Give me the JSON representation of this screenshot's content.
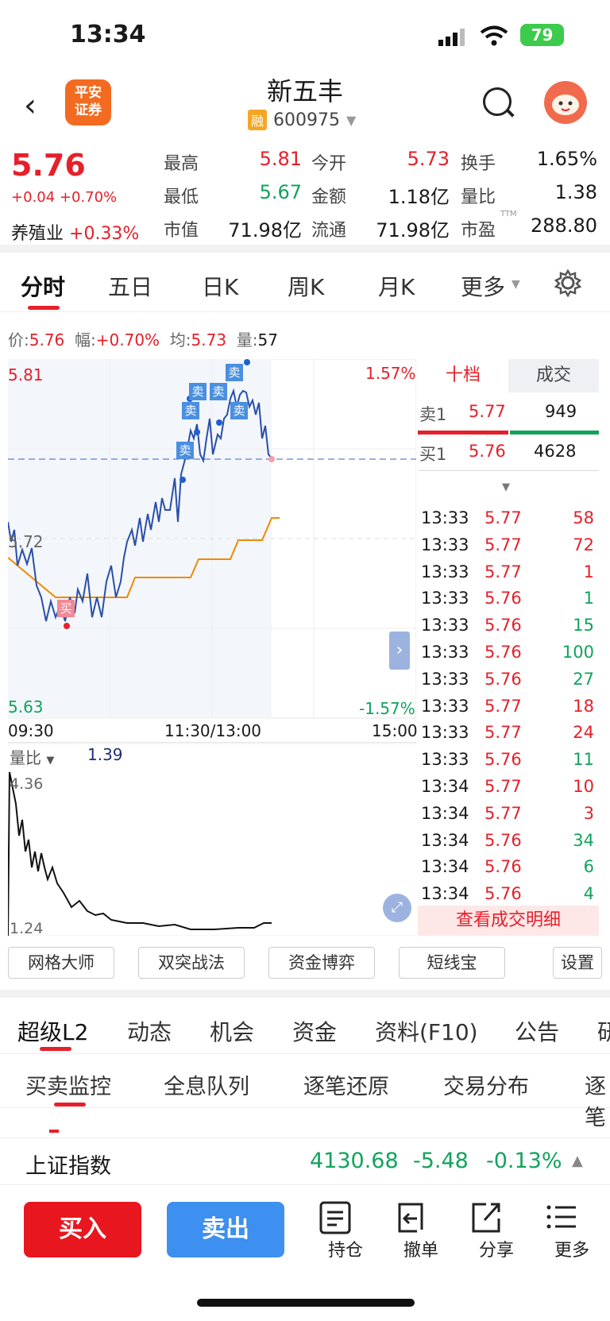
{
  "status": {
    "time": "13:34",
    "battery": "79"
  },
  "header": {
    "title": "新五丰",
    "margin_tag": "融",
    "code": "600975",
    "logo_text": "平安证券"
  },
  "quote": {
    "price": "5.76",
    "change": "+0.04 +0.70%",
    "sector_name": "养殖业",
    "sector_change": "+0.33%",
    "fields": [
      {
        "label": "最高",
        "value": "5.81",
        "color": "red"
      },
      {
        "label": "今开",
        "value": "5.73",
        "color": "red"
      },
      {
        "label": "换手",
        "value": "1.65%",
        "color": "black"
      },
      {
        "label": "最低",
        "value": "5.67",
        "color": "green"
      },
      {
        "label": "金额",
        "value": "1.18亿",
        "color": "black"
      },
      {
        "label": "量比",
        "value": "1.38",
        "color": "black"
      },
      {
        "label": "市值",
        "value": "71.98亿",
        "color": "black"
      },
      {
        "label": "流通",
        "value": "71.98亿",
        "color": "black"
      },
      {
        "label": "市盈",
        "value": "288.80",
        "color": "black"
      }
    ],
    "ttm": "TTM"
  },
  "tabs": [
    "分时",
    "五日",
    "日K",
    "周K",
    "月K",
    "更多"
  ],
  "infobar": {
    "price_label": "价:",
    "price": "5.76",
    "amp_label": "幅:",
    "amp": "+0.70%",
    "avg_label": "均:",
    "avg": "5.73",
    "vol_label": "量:",
    "vol": "57"
  },
  "chart": {
    "y_high": "5.81",
    "y_mid": "5.72",
    "y_low": "5.63",
    "pct_high": "1.57%",
    "pct_low": "-1.57%",
    "x_start": "09:30",
    "x_mid": "11:30/13:00",
    "x_end": "15:00",
    "vol_label": "量比",
    "vol_value": "1.39",
    "vol_high": "4.36",
    "vol_low": "1.24",
    "markers": {
      "buy": "买",
      "sell": "卖"
    }
  },
  "depth": {
    "tabs": [
      "十档",
      "成交"
    ],
    "sell1": {
      "label": "卖1",
      "price": "5.77",
      "vol": "949"
    },
    "buy1": {
      "label": "买1",
      "price": "5.76",
      "vol": "4628"
    },
    "ticks": [
      {
        "t": "13:33",
        "p": "5.77",
        "v": "58",
        "c": "red"
      },
      {
        "t": "13:33",
        "p": "5.77",
        "v": "72",
        "c": "red"
      },
      {
        "t": "13:33",
        "p": "5.77",
        "v": "1",
        "c": "red"
      },
      {
        "t": "13:33",
        "p": "5.76",
        "v": "1",
        "c": "green"
      },
      {
        "t": "13:33",
        "p": "5.76",
        "v": "15",
        "c": "green"
      },
      {
        "t": "13:33",
        "p": "5.76",
        "v": "100",
        "c": "green"
      },
      {
        "t": "13:33",
        "p": "5.76",
        "v": "27",
        "c": "green"
      },
      {
        "t": "13:33",
        "p": "5.77",
        "v": "18",
        "c": "red"
      },
      {
        "t": "13:33",
        "p": "5.77",
        "v": "24",
        "c": "red"
      },
      {
        "t": "13:33",
        "p": "5.76",
        "v": "11",
        "c": "green"
      },
      {
        "t": "13:34",
        "p": "5.77",
        "v": "10",
        "c": "red"
      },
      {
        "t": "13:34",
        "p": "5.77",
        "v": "3",
        "c": "red"
      },
      {
        "t": "13:34",
        "p": "5.76",
        "v": "34",
        "c": "green"
      },
      {
        "t": "13:34",
        "p": "5.76",
        "v": "6",
        "c": "green"
      },
      {
        "t": "13:34",
        "p": "5.76",
        "v": "4",
        "c": "green"
      }
    ],
    "more": "查看成交明细"
  },
  "tools": [
    "网格大师",
    "双突战法",
    "资金博弈",
    "短线宝",
    "设置"
  ],
  "section_tabs": [
    "超级L2",
    "动态",
    "机会",
    "资金",
    "资料(F10)",
    "公告",
    "研"
  ],
  "sub_tabs": [
    "买卖监控",
    "全息队列",
    "逐笔还原",
    "交易分布",
    "逐笔"
  ],
  "index": {
    "name": "上证指数",
    "value": "4130.68",
    "change": "-5.48",
    "pct": "-0.13%"
  },
  "bottom": {
    "buy": "买入",
    "sell": "卖出",
    "icons": [
      "持仓",
      "撤单",
      "分享",
      "更多"
    ]
  }
}
